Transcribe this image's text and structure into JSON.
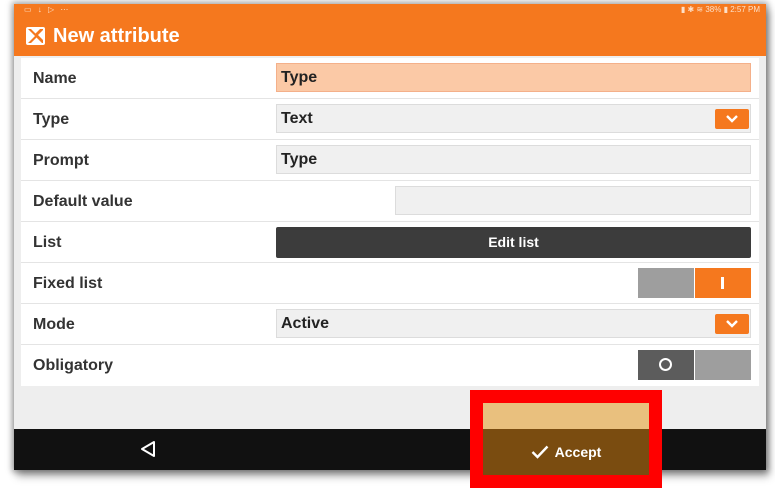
{
  "status_bar": {
    "left_icons": "▭ ↓ ▷ ⋯",
    "right_text": "▮ ✱ ≋ 38% ▮ 2:57 PM"
  },
  "header": {
    "logo_icon": "x-logo-icon",
    "title": "New attribute"
  },
  "form": {
    "name": {
      "label": "Name",
      "value": "Type"
    },
    "type": {
      "label": "Type",
      "value": "Text"
    },
    "prompt": {
      "label": "Prompt",
      "value": "Type"
    },
    "default_value": {
      "label": "Default value",
      "value": ""
    },
    "list": {
      "label": "List",
      "button_label": "Edit list"
    },
    "fixed_list": {
      "label": "Fixed list",
      "state": "on"
    },
    "mode": {
      "label": "Mode",
      "value": "Active"
    },
    "obligatory": {
      "label": "Obligatory",
      "state": "off"
    }
  },
  "nav": {
    "back_icon": "triangle-back-icon"
  },
  "accept": {
    "label": "Accept",
    "icon": "checkmark-icon"
  },
  "colors": {
    "accent": "#f5781e",
    "accept": "#7a4c10",
    "highlight_frame": "#ff0000"
  }
}
